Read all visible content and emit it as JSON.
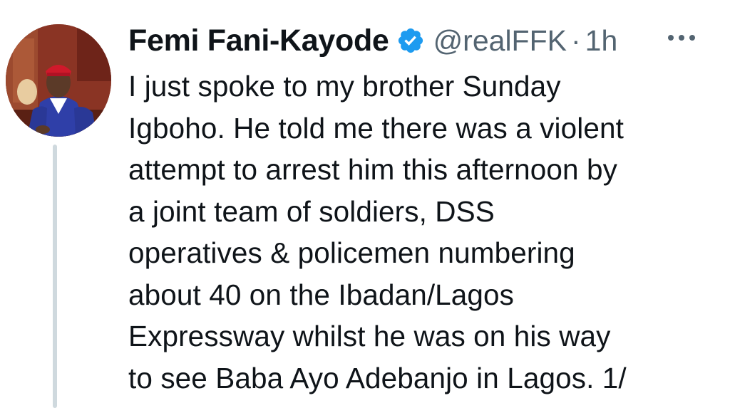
{
  "tweet": {
    "display_name": "Femi Fani-Kayode",
    "handle": "@realFFK",
    "separator": "·",
    "time": "1h",
    "verified": true,
    "body_lines": [
      "I just spoke to my brother Sunday",
      "Igboho. He told me there was a violent",
      "attempt to arrest him this afternoon by",
      "a joint team of soldiers, DSS",
      "operatives & policemen numbering",
      "about 40 on the Ibadan/Lagos",
      "Expressway whilst he was on his way",
      "to see Baba Ayo Adebanjo in Lagos. 1/"
    ]
  },
  "icons": {
    "avatar": "profile-photo",
    "verified": "verified-badge-icon",
    "more": "more-options-icon"
  },
  "colors": {
    "text": "#0f1419",
    "secondary": "#536471",
    "verified_blue": "#1d9bf0",
    "thread_line": "#cfd9de"
  }
}
